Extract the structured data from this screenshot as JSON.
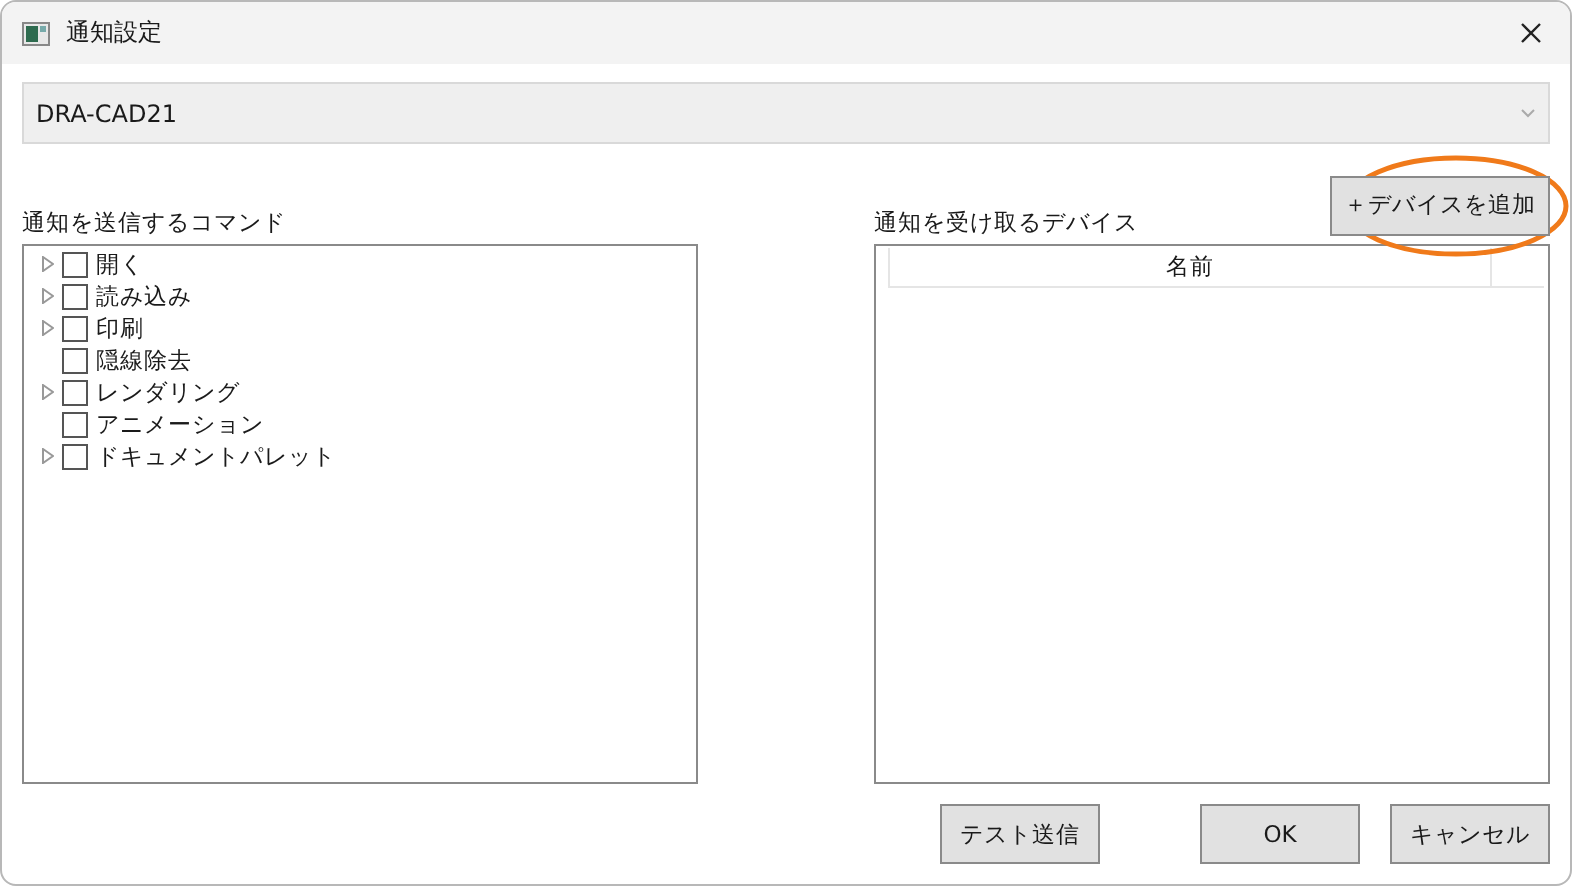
{
  "window": {
    "title": "通知設定"
  },
  "profile_select": {
    "value": "DRA-CAD21"
  },
  "commands": {
    "label": "通知を送信するコマンド",
    "items": [
      {
        "label": "開く",
        "expandable": true,
        "checked": false
      },
      {
        "label": "読み込み",
        "expandable": true,
        "checked": false
      },
      {
        "label": "印刷",
        "expandable": true,
        "checked": false
      },
      {
        "label": "隠線除去",
        "expandable": false,
        "checked": false
      },
      {
        "label": "レンダリング",
        "expandable": true,
        "checked": false
      },
      {
        "label": "アニメーション",
        "expandable": false,
        "checked": false
      },
      {
        "label": "ドキュメントパレット",
        "expandable": true,
        "checked": false
      }
    ]
  },
  "devices": {
    "label": "通知を受け取るデバイス",
    "add_button": "＋デバイスを追加",
    "add_button_highlighted": true,
    "columns": [
      "名前"
    ]
  },
  "buttons": {
    "test": "テスト送信",
    "ok": "OK",
    "cancel": "キャンセル"
  }
}
